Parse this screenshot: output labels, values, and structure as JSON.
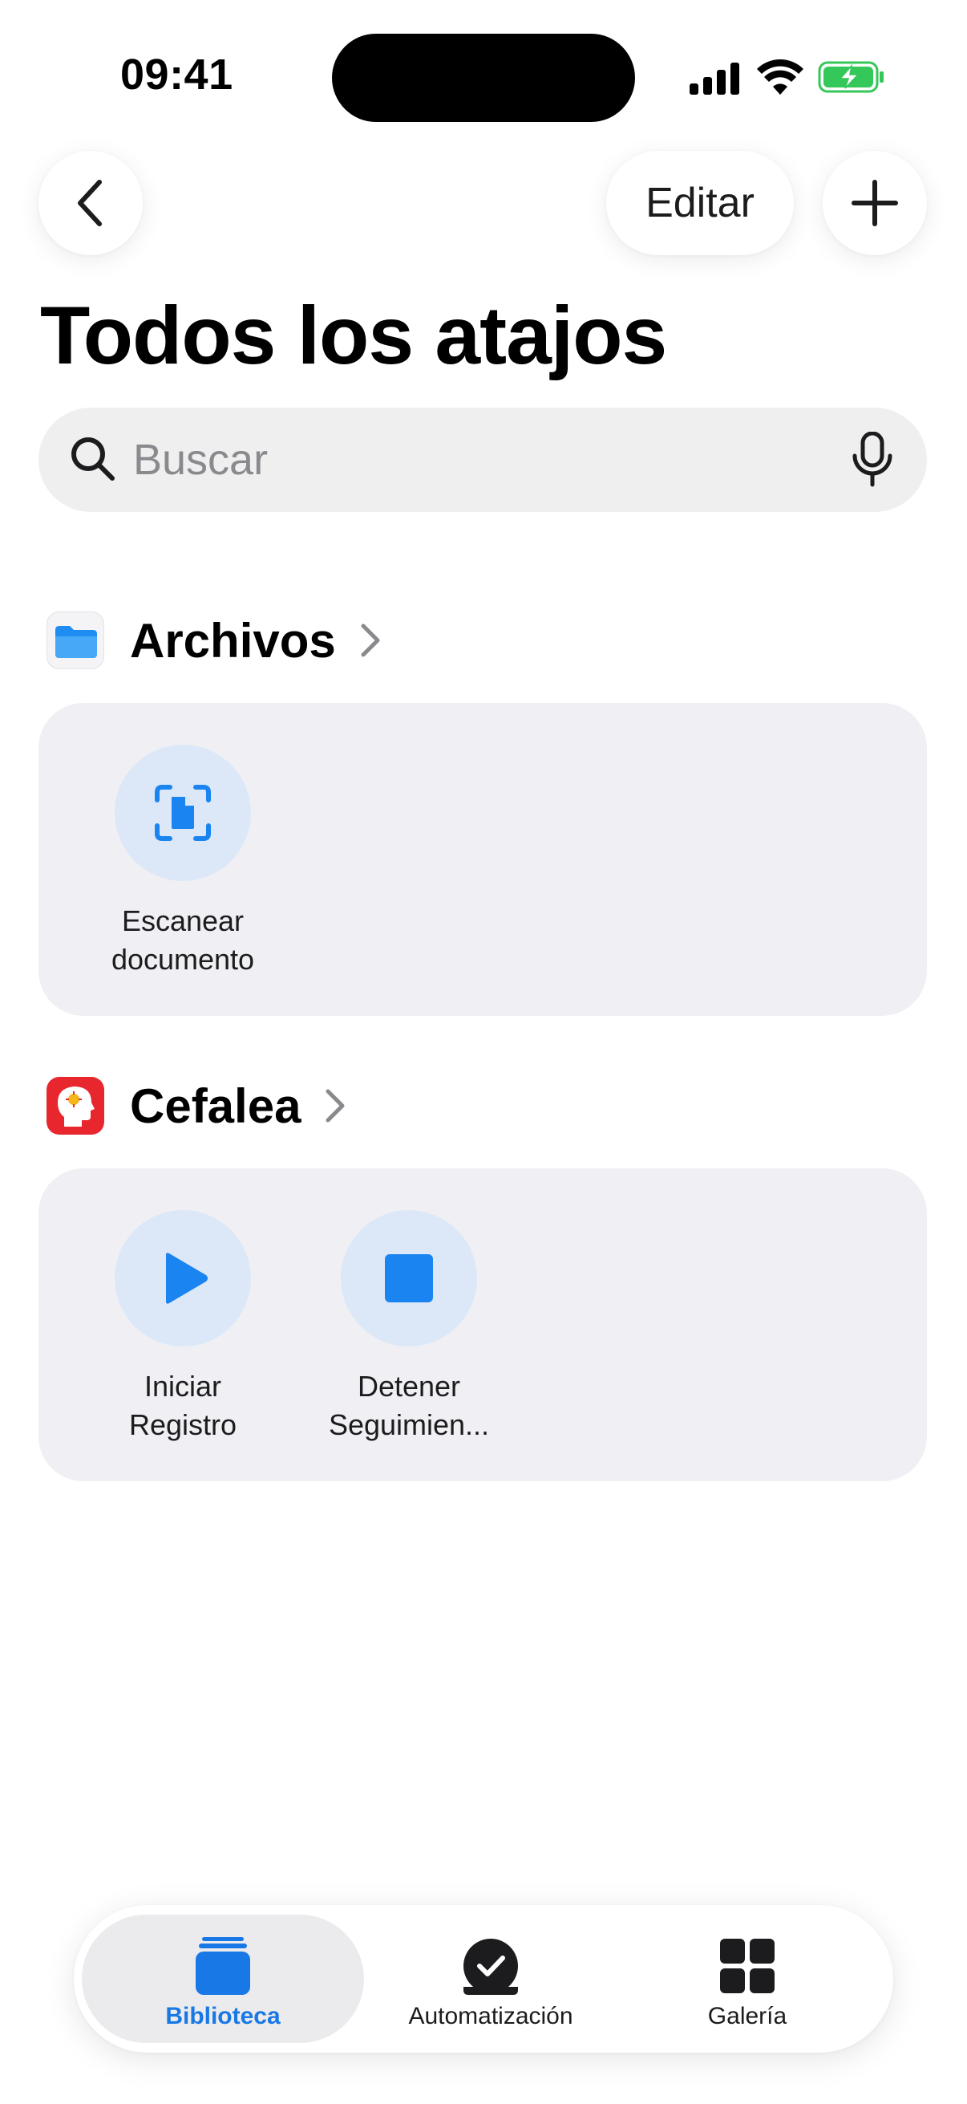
{
  "status_bar": {
    "time": "09:41"
  },
  "nav": {
    "edit_label": "Editar"
  },
  "page": {
    "title": "Todos los atajos"
  },
  "search": {
    "placeholder": "Buscar"
  },
  "sections": [
    {
      "title": "Archivos",
      "icon": "folder-icon",
      "shortcuts": [
        {
          "label": "Escanear\ndocumento",
          "icon": "scan-document-icon"
        }
      ]
    },
    {
      "title": "Cefalea",
      "icon": "cefalea-app-icon",
      "shortcuts": [
        {
          "label": "Iniciar\nRegistro",
          "icon": "play-icon"
        },
        {
          "label": "Detener\nSeguimien...",
          "icon": "stop-icon"
        }
      ]
    }
  ],
  "tabbar": {
    "tabs": [
      {
        "label": "Biblioteca",
        "icon": "library-icon",
        "active": true
      },
      {
        "label": "Automatización",
        "icon": "automation-icon",
        "active": false
      },
      {
        "label": "Galería",
        "icon": "gallery-grid-icon",
        "active": false
      }
    ]
  },
  "colors": {
    "accent": "#1878e6",
    "shortcut_bg": "#dce8f7",
    "card_bg": "#f0f0f4",
    "cefalea_red": "#e8262d",
    "battery_green": "#34c759"
  }
}
